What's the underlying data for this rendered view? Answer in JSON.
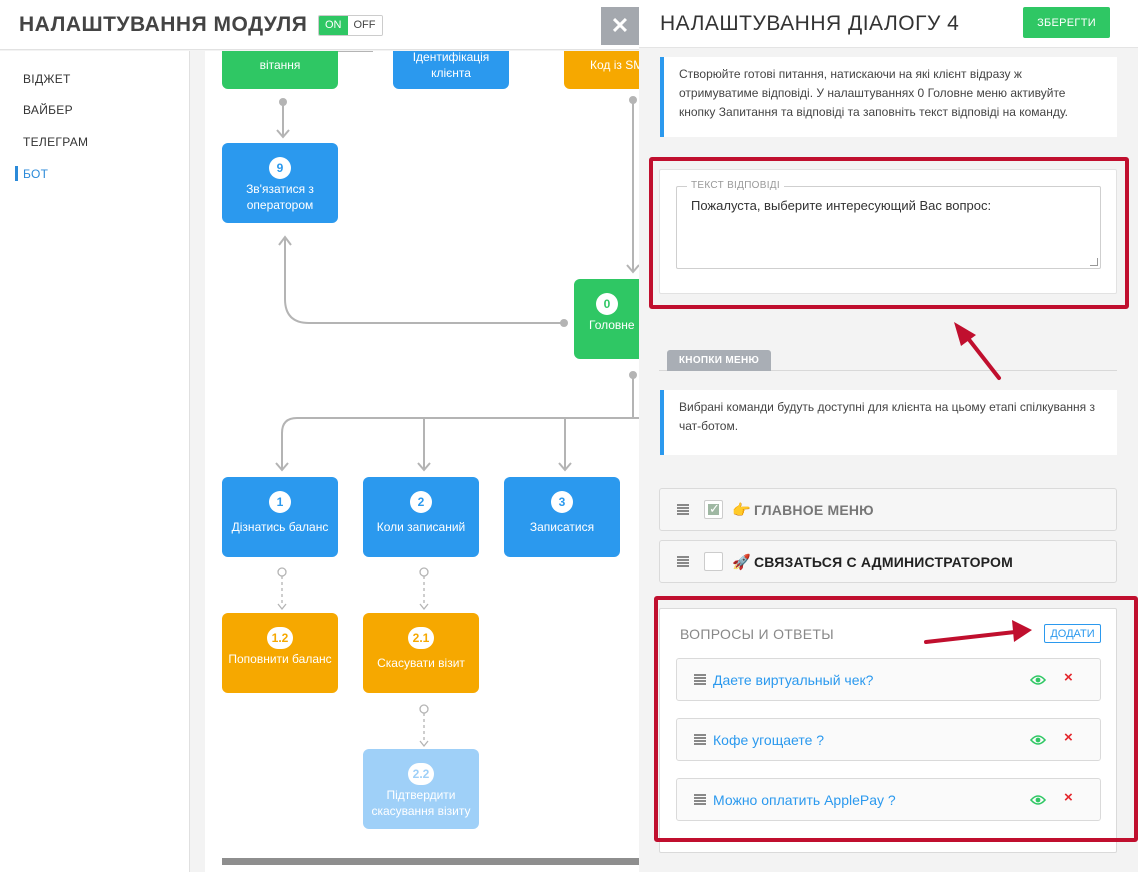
{
  "module": {
    "title": "НАЛАШТУВАННЯ МОДУЛЯ",
    "toggle_on": "ON",
    "toggle_off": "OFF"
  },
  "sidebar": {
    "items": [
      {
        "label": "ВІДЖЕТ"
      },
      {
        "label": "ВАЙБЕР"
      },
      {
        "label": "ТЕЛЕГРАМ"
      },
      {
        "label": "БОТ",
        "active": true
      }
    ]
  },
  "flow": {
    "nodes": [
      {
        "id": "greeting",
        "label": "вітання",
        "color": "green"
      },
      {
        "id": "identify",
        "label": "Ідентифікація клієнта",
        "color": "blue"
      },
      {
        "id": "code",
        "label": "Код із SM",
        "color": "orange"
      },
      {
        "id": "n9",
        "number": "9",
        "label": "Зв'язатися з оператором",
        "color": "blue"
      },
      {
        "id": "n0",
        "number": "0",
        "label": "Головне",
        "color": "green"
      },
      {
        "id": "n1",
        "number": "1",
        "label": "Дізнатись баланс",
        "color": "blue"
      },
      {
        "id": "n2",
        "number": "2",
        "label": "Коли записаний",
        "color": "blue"
      },
      {
        "id": "n3",
        "number": "3",
        "label": "Записатися",
        "color": "blue"
      },
      {
        "id": "n12",
        "number": "1.2",
        "label": "Поповнити баланс",
        "color": "orange"
      },
      {
        "id": "n21",
        "number": "2.1",
        "label": "Скасувати візит",
        "color": "orange"
      },
      {
        "id": "n22",
        "number": "2.2",
        "label": "Підтвердити скасування візиту",
        "color": "lightblue"
      }
    ]
  },
  "close_symbol": "✕",
  "panel": {
    "title": "НАЛАШТУВАННЯ ДІАЛОГУ 4",
    "save_label": "ЗБЕРЕГТИ",
    "info_top": "Створюйте готові питання, натискаючи на які клієнт відразу ж отримуватиме відповіді. У налаштуваннях 0 Головне меню активуйте кнопку Запитання та відповіді та заповніть текст відповіді на команду.",
    "reply": {
      "legend": "ТЕКСТ ВІДПОВІДІ",
      "value": "Пожалуста, выберите интересующий Вас вопрос:"
    },
    "menu_tab": "КНОПКИ МЕНЮ",
    "info_menu": "Вибрані команди будуть доступні для клієнта на цьому етапі спілкування з чат-ботом.",
    "commands": [
      {
        "emoji": "👉",
        "label": "ГЛАВНОЕ МЕНЮ",
        "checked": true
      },
      {
        "emoji": "🚀",
        "label": "СВЯЗАТЬСЯ С АДМИНИСТРАТОРОМ",
        "checked": false
      }
    ],
    "qa": {
      "title": "ВОПРОСЫ И ОТВЕТЫ",
      "add_label": "ДОДАТИ",
      "items": [
        {
          "text": "Даете виртуальный чек?"
        },
        {
          "text": "Кофе угощаете ?"
        },
        {
          "text": "Можно оплатить ApplePay ?"
        }
      ]
    }
  },
  "colors": {
    "accent_blue": "#2b99ee",
    "green": "#2fc764",
    "orange": "#f6a800",
    "annotation_red": "#c00f2e",
    "delete_red": "#e4262c"
  }
}
